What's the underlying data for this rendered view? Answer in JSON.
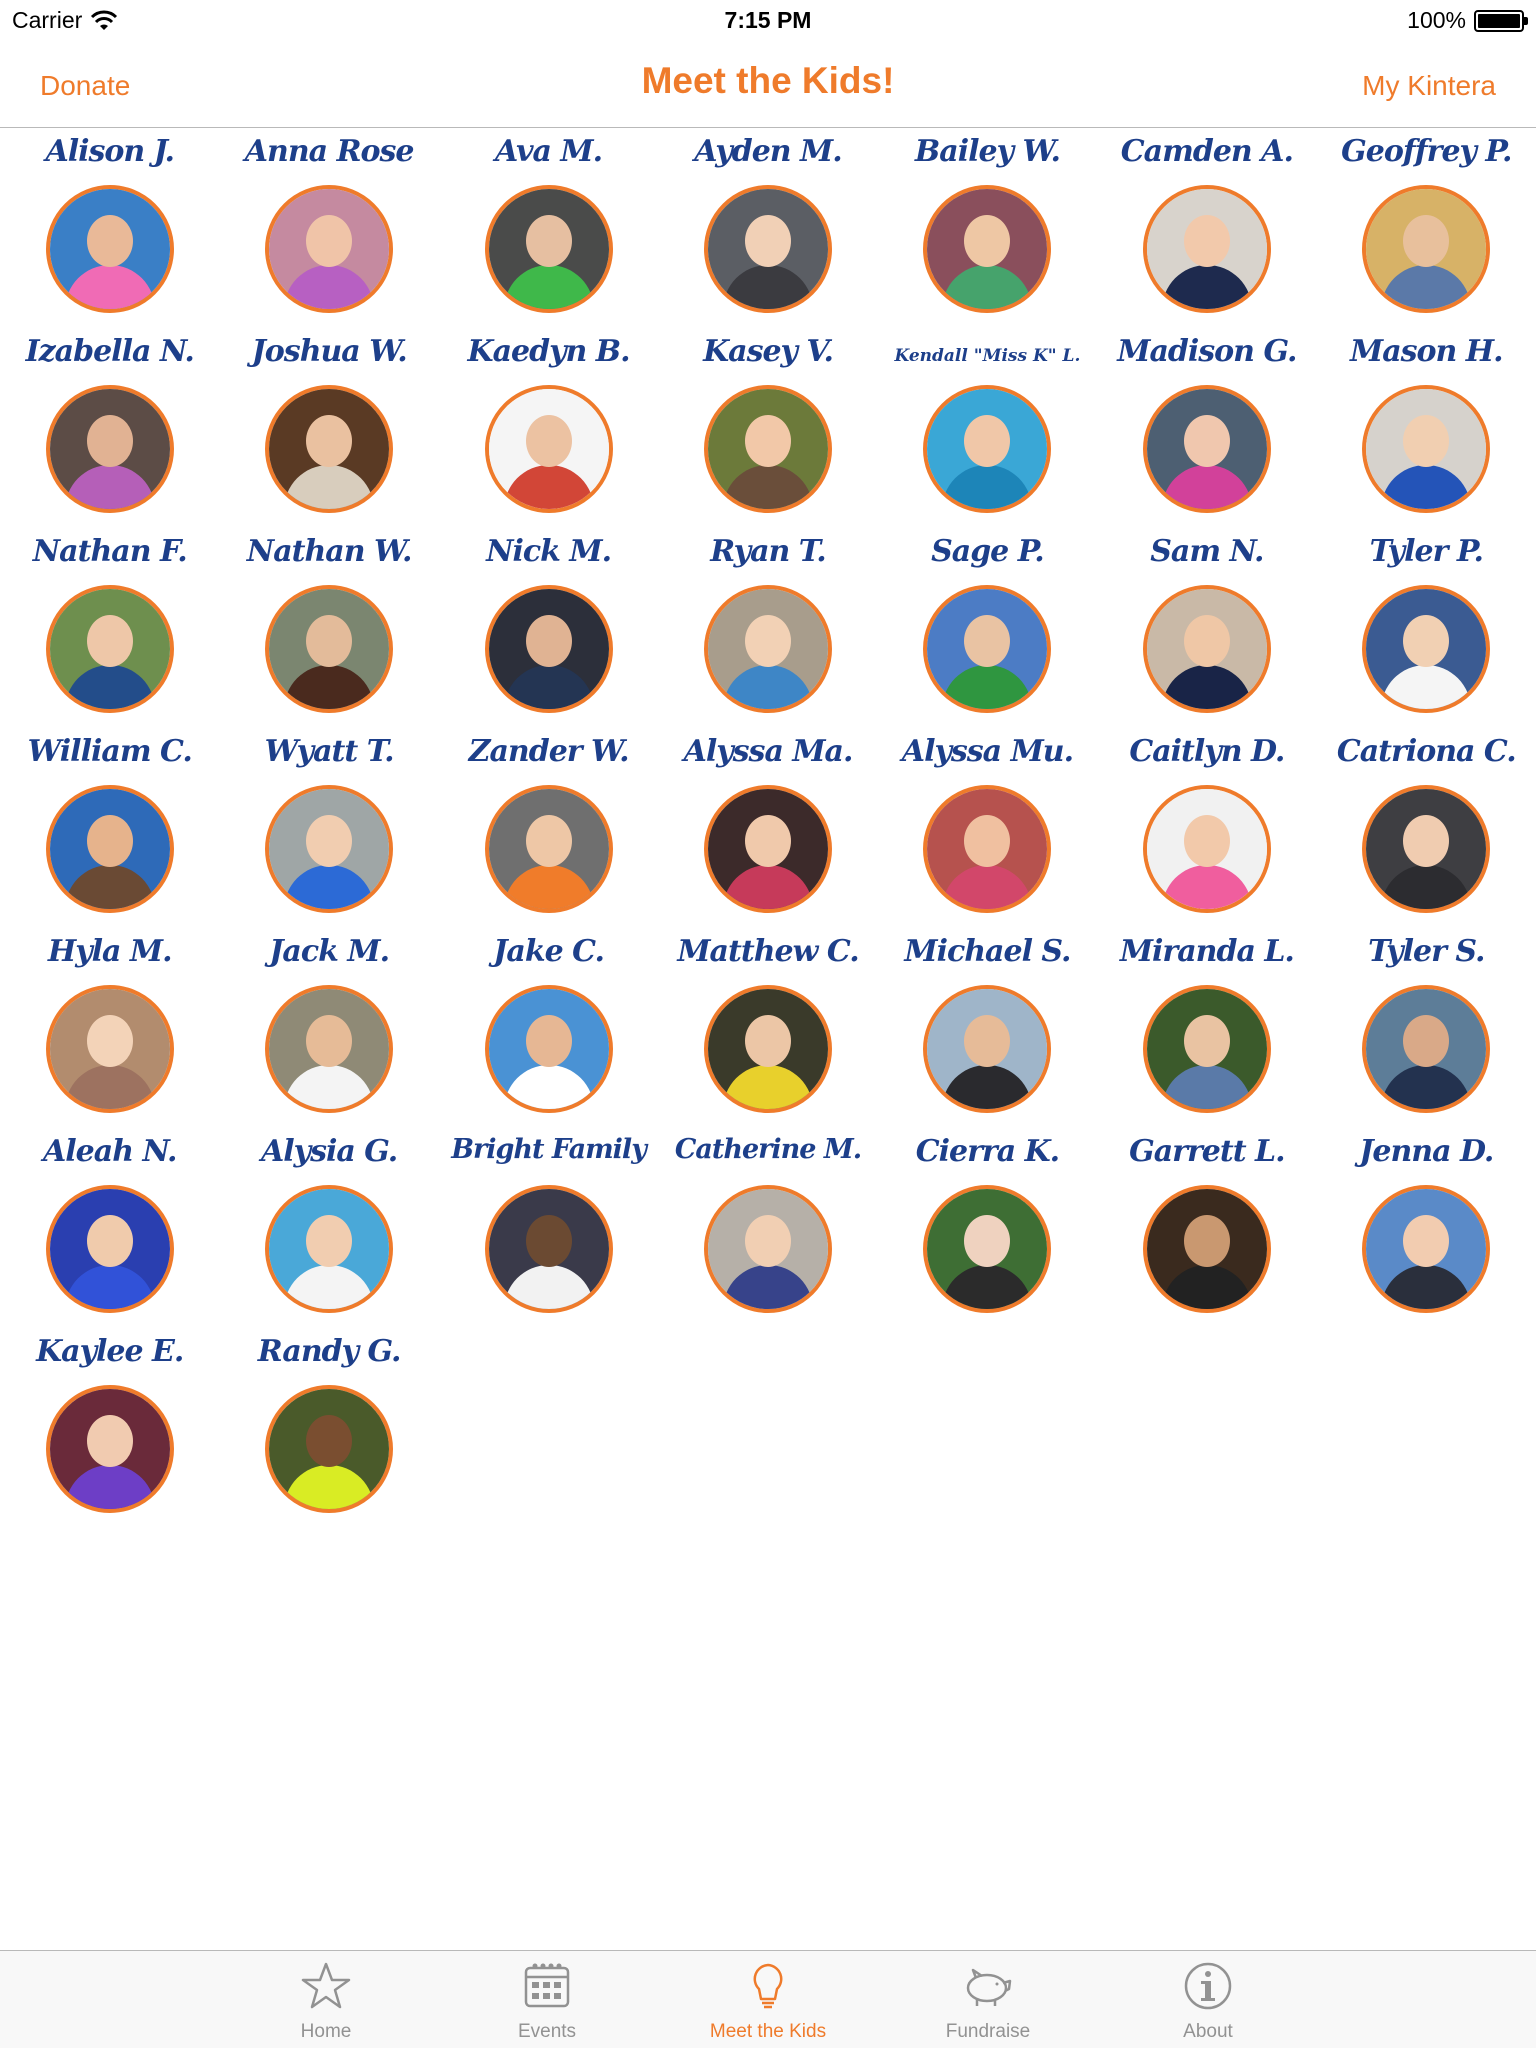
{
  "status_bar": {
    "carrier": "Carrier",
    "time": "7:15 PM",
    "battery": "100%"
  },
  "nav": {
    "left": "Donate",
    "title": "Meet the Kids!",
    "right": "My Kintera"
  },
  "kids": [
    {
      "name": "Alison J.",
      "bg": "#3a7fc6",
      "face": "#e9b998",
      "body": "#f06bb5"
    },
    {
      "name": "Anna Rose",
      "bg": "#c58aa0",
      "face": "#f0c4a8",
      "body": "#b760c2"
    },
    {
      "name": "Ava M.",
      "bg": "#4a4b4a",
      "face": "#e6bfa1",
      "body": "#3fb84a"
    },
    {
      "name": "Ayden M.",
      "bg": "#5b5e64",
      "face": "#f1d0b6",
      "body": "#3b3b40"
    },
    {
      "name": "Bailey W.",
      "bg": "#8a4f5c",
      "face": "#eec7a4",
      "body": "#46a36c"
    },
    {
      "name": "Camden A.",
      "bg": "#d8d3cc",
      "face": "#f2c9ab",
      "body": "#1e2a4e"
    },
    {
      "name": "Geoffrey P.",
      "bg": "#d7b267",
      "face": "#e8c09c",
      "body": "#5b79a8"
    },
    {
      "name": "Izabella N.",
      "bg": "#5c4c46",
      "face": "#e1b293",
      "body": "#b55fb8"
    },
    {
      "name": "Joshua W.",
      "bg": "#5a3a24",
      "face": "#eac1a0",
      "body": "#d8cdbd"
    },
    {
      "name": "Kaedyn B.",
      "bg": "#f5f5f5",
      "face": "#ecc2a2",
      "body": "#d24637"
    },
    {
      "name": "Kasey V.",
      "bg": "#6c7a3a",
      "face": "#f2c8a8",
      "body": "#6a4e3a"
    },
    {
      "name": "Kendall \"Miss K\" L.",
      "bg": "#3aa7d6",
      "face": "#f0c7a8",
      "body": "#1d85b8"
    },
    {
      "name": "Madison G.",
      "bg": "#4d5f72",
      "face": "#f0c7ae",
      "body": "#d2419a"
    },
    {
      "name": "Mason H.",
      "bg": "#d6d2cc",
      "face": "#f1cfb1",
      "body": "#2454b8"
    },
    {
      "name": "Nathan F.",
      "bg": "#6e8f4e",
      "face": "#eec7a8",
      "body": "#234d8a"
    },
    {
      "name": "Nathan W.",
      "bg": "#7b8670",
      "face": "#e3bb9a",
      "body": "#4a2a1e"
    },
    {
      "name": "Nick M.",
      "bg": "#2c2f3a",
      "face": "#e0b393",
      "body": "#243553"
    },
    {
      "name": "Ryan T.",
      "bg": "#a89d8c",
      "face": "#f2d1b5",
      "body": "#3e86c6"
    },
    {
      "name": "Sage P.",
      "bg": "#4c7cc5",
      "face": "#e9c3a3",
      "body": "#2f9640"
    },
    {
      "name": "Sam N.",
      "bg": "#c9b9a7",
      "face": "#efc7a6",
      "body": "#192447"
    },
    {
      "name": "Tyler P.",
      "bg": "#3b5b92",
      "face": "#f1d0b3",
      "body": "#f5f5f5"
    },
    {
      "name": "William C.",
      "bg": "#2e6ab8",
      "face": "#e6b38c",
      "body": "#6a4a34"
    },
    {
      "name": "Wyatt T.",
      "bg": "#9fa6a6",
      "face": "#f1cdb0",
      "body": "#2c6ad6"
    },
    {
      "name": "Zander W.",
      "bg": "#6f6f6f",
      "face": "#eec7a6",
      "body": "#f07c2a"
    },
    {
      "name": "Alyssa Ma.",
      "bg": "#3c2a2a",
      "face": "#f0c9ab",
      "body": "#c63a5a"
    },
    {
      "name": "Alyssa Mu.",
      "bg": "#b6524e",
      "face": "#f0c0a0",
      "body": "#d2476a"
    },
    {
      "name": "Caitlyn D.",
      "bg": "#f1f1f1",
      "face": "#f2c9aa",
      "body": "#f05e9e"
    },
    {
      "name": "Catriona C.",
      "bg": "#3e3e42",
      "face": "#f0ccb0",
      "body": "#2c2c30"
    },
    {
      "name": "Hyla M.",
      "bg": "#b28c6e",
      "face": "#f3d3b8",
      "body": "#9d7260"
    },
    {
      "name": "Jack M.",
      "bg": "#8f8a76",
      "face": "#e6bb97",
      "body": "#f4f4f4"
    },
    {
      "name": "Jake C.",
      "bg": "#4a92d4",
      "face": "#e6b794",
      "body": "#ffffff"
    },
    {
      "name": "Matthew C.",
      "bg": "#3a3a2a",
      "face": "#ecc6a6",
      "body": "#e8d02c"
    },
    {
      "name": "Michael S.",
      "bg": "#9fb5c9",
      "face": "#e6bb98",
      "body": "#2a2a2e"
    },
    {
      "name": "Miranda L.",
      "bg": "#3b5a2b",
      "face": "#e9c3a2",
      "body": "#5a7aa8"
    },
    {
      "name": "Tyler S.",
      "bg": "#5d7d98",
      "face": "#d9a988",
      "body": "#23324f"
    },
    {
      "name": "Aleah N.",
      "bg": "#2a3fb0",
      "face": "#f0cbac",
      "body": "#3152d8"
    },
    {
      "name": "Alysia G.",
      "bg": "#4aa8d8",
      "face": "#f1cdb0",
      "body": "#f4f4f4"
    },
    {
      "name": "Bright Family",
      "bg": "#3a3a4a",
      "face": "#6b4a32",
      "body": "#f2f2f2"
    },
    {
      "name": "Catherine M.",
      "bg": "#b6b0a8",
      "face": "#f1cfb3",
      "body": "#37438a"
    },
    {
      "name": "Cierra K.",
      "bg": "#3e6e34",
      "face": "#efd2bf",
      "body": "#2b2b2b"
    },
    {
      "name": "Garrett L.",
      "bg": "#3a2a1e",
      "face": "#c99870",
      "body": "#222222"
    },
    {
      "name": "Jenna D.",
      "bg": "#5a8ac8",
      "face": "#f2ccb0",
      "body": "#2a2f3c"
    },
    {
      "name": "Kaylee E.",
      "bg": "#6a2a3a",
      "face": "#f1cbb0",
      "body": "#6d3ec6"
    },
    {
      "name": "Randy G.",
      "bg": "#4a5a2a",
      "face": "#7a4e30",
      "body": "#d9ec24"
    }
  ],
  "tabs": [
    {
      "label": "Home",
      "icon": "star-icon"
    },
    {
      "label": "Events",
      "icon": "calendar-icon"
    },
    {
      "label": "Meet the Kids",
      "icon": "lightbulb-icon"
    },
    {
      "label": "Fundraise",
      "icon": "piggy-bank-icon"
    },
    {
      "label": "About",
      "icon": "info-icon"
    }
  ],
  "colors": {
    "accent": "#ef7b2b",
    "name_blue": "#1d3f8a",
    "tab_inactive": "#929292"
  }
}
